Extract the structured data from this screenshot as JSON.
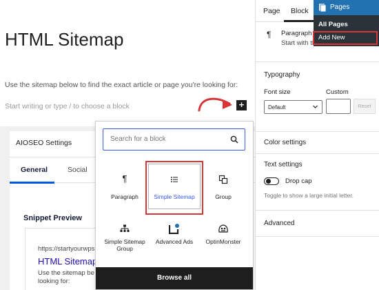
{
  "editor": {
    "title": "HTML Sitemap",
    "intro": "Use the sitemap below to find the exact article or page you're looking for:",
    "placeholder": "Start writing or type / to choose a block",
    "inserter_symbol": "+"
  },
  "aioseo": {
    "title": "AIOSEO Settings",
    "tabs": [
      "General",
      "Social"
    ],
    "snippet_heading": "Snippet Preview",
    "snippet_url": "https://startyourwps",
    "snippet_title": "HTML Sitemap",
    "snippet_desc": "Use the sitemap be looking for:"
  },
  "inserter": {
    "search_placeholder": "Search for a block",
    "blocks": [
      {
        "label": "Paragraph",
        "icon": "paragraph-icon"
      },
      {
        "label": "Simple Sitemap",
        "icon": "list-icon"
      },
      {
        "label": "Group",
        "icon": "group-icon"
      },
      {
        "label": "Simple Sitemap Group",
        "icon": "sitemap-icon"
      },
      {
        "label": "Advanced Ads",
        "icon": "advanced-ads-icon"
      },
      {
        "label": "OptinMonster",
        "icon": "optinmonster-icon"
      }
    ],
    "browse_all": "Browse all"
  },
  "sidebar": {
    "tabs": [
      "Page",
      "Block"
    ],
    "block_card": {
      "title": "Paragraph",
      "description": "Start with th narrative."
    },
    "typography": {
      "title": "Typography",
      "font_size_label": "Font size",
      "custom_label": "Custom",
      "select_value": "Default",
      "reset_label": "Reset"
    },
    "color_settings": "Color settings",
    "text_settings": {
      "title": "Text settings",
      "drop_cap": "Drop cap",
      "help": "Toggle to show a large initial letter."
    },
    "advanced": "Advanced"
  },
  "admin_menu": {
    "header": "Pages",
    "items": [
      "All Pages",
      "Add New"
    ]
  },
  "colors": {
    "accent": "#3858e9",
    "highlight": "#d63638",
    "admin_blue": "#2271b1",
    "admin_dark": "#2c3338"
  }
}
